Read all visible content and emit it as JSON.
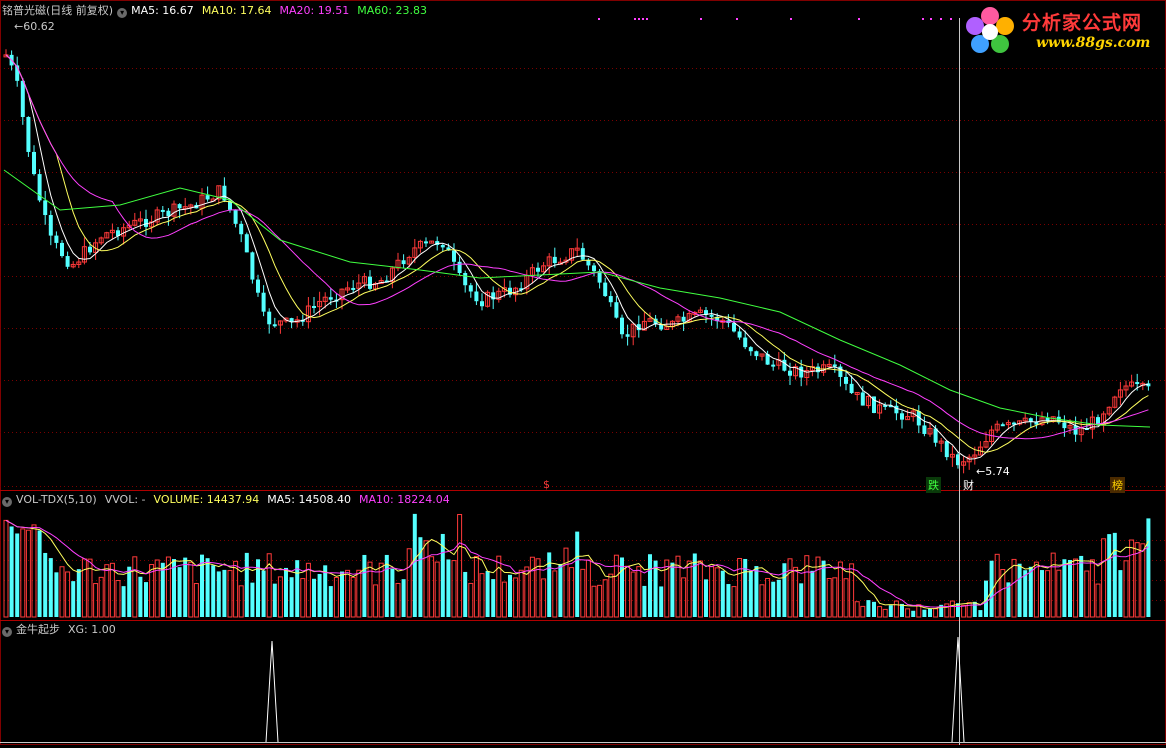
{
  "main_panel": {
    "title": "铭普光磁(日线 前复权)",
    "indicators": [
      {
        "label": "MA5: 16.67",
        "color": "#ffffff"
      },
      {
        "label": "MA10: 17.64",
        "color": "#ffff5f"
      },
      {
        "label": "MA20: 19.51",
        "color": "#ff40ff"
      },
      {
        "label": "MA60: 23.83",
        "color": "#40ff40"
      }
    ],
    "high_label": "60.62",
    "low_label": "5.74",
    "markers": [
      {
        "text": "$",
        "color": "#ff3a3a"
      },
      {
        "text": "跌",
        "color": "#40ff40"
      },
      {
        "text": "财",
        "color": "#ffffff"
      },
      {
        "text": "榜",
        "color": "#ffd400"
      }
    ]
  },
  "volume_panel": {
    "title": "VOL-TDX(5,10)",
    "indicators": [
      {
        "label": "VVOL: -",
        "color": "#c8c8c8"
      },
      {
        "label": "VOLUME: 14437.94",
        "color": "#ffff5f"
      },
      {
        "label": "MA5: 14508.40",
        "color": "#ffffff"
      },
      {
        "label": "MA10: 18224.04",
        "color": "#ff40ff"
      }
    ]
  },
  "signal_panel": {
    "title": "金牛起步",
    "indicators": [
      {
        "label": "XG: 1.00",
        "color": "#c8c8c8"
      }
    ]
  },
  "logo": {
    "brand": "分析家公式网",
    "url": "www.88gs.com"
  },
  "colors": {
    "up": "#ff3a3a",
    "down": "#54ffff",
    "grid": "#7a0000"
  }
}
